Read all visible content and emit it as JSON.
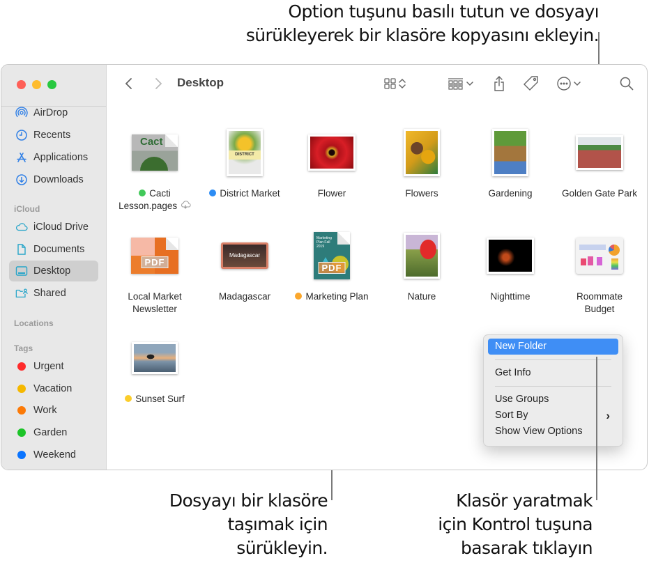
{
  "callouts": {
    "top": [
      "Option tuşunu basılı tutun ve dosyayı",
      "sürükleyerek bir klasöre kopyasını ekleyin."
    ],
    "drag": [
      "Dosyayı bir klasöre",
      "taşımak için",
      "sürükleyin."
    ],
    "control_click": [
      "Klasör yaratmak",
      "için Kontrol tuşuna",
      "basarak tıklayın"
    ]
  },
  "window": {
    "title": "Desktop",
    "traffic_lights": {
      "close": "#fe5f57",
      "minimize": "#febc2e",
      "zoom": "#28c840"
    }
  },
  "toolbar": {
    "back": "back-icon",
    "forward": "forward-icon",
    "view_mode": "icon-grid-icon",
    "group": "group-icon",
    "share": "share-icon",
    "tags": "tag-icon",
    "more": "more-icon",
    "search": "search-icon"
  },
  "sidebar": {
    "favorites": [
      {
        "label": "AirDrop",
        "icon": "airdrop-icon"
      },
      {
        "label": "Recents",
        "icon": "clock-icon"
      },
      {
        "label": "Applications",
        "icon": "applications-icon"
      },
      {
        "label": "Downloads",
        "icon": "download-icon"
      }
    ],
    "icloud_header": "iCloud",
    "icloud": [
      {
        "label": "iCloud Drive",
        "icon": "cloud-icon"
      },
      {
        "label": "Documents",
        "icon": "document-icon"
      },
      {
        "label": "Desktop",
        "icon": "desktop-icon",
        "selected": true
      },
      {
        "label": "Shared",
        "icon": "shared-folder-icon"
      }
    ],
    "locations_header": "Locations",
    "tags_header": "Tags",
    "tags": [
      {
        "label": "Urgent",
        "color": "#fe2b2b"
      },
      {
        "label": "Vacation",
        "color": "#f5b800"
      },
      {
        "label": "Work",
        "color": "#fc7a07"
      },
      {
        "label": "Garden",
        "color": "#1cc428"
      },
      {
        "label": "Weekend",
        "color": "#0a74ff"
      }
    ]
  },
  "files": [
    {
      "name": "Cacti Lesson.pages",
      "line1": "Cacti",
      "line2": "Lesson.pages",
      "tag": "#42c95a",
      "icloud": true
    },
    {
      "name": "District Market",
      "line1": "District Market",
      "tag": "#2c8cf4"
    },
    {
      "name": "Flower",
      "line1": "Flower"
    },
    {
      "name": "Flowers",
      "line1": "Flowers"
    },
    {
      "name": "Gardening",
      "line1": "Gardening"
    },
    {
      "name": "Golden Gate Park",
      "line1": "Golden Gate Park"
    },
    {
      "name": "Local Market Newsletter",
      "line1": "Local Market",
      "line2": "Newsletter",
      "badge": "PDF"
    },
    {
      "name": "Madagascar",
      "line1": "Madagascar"
    },
    {
      "name": "Marketing Plan",
      "line1": "Marketing Plan",
      "tag": "#fba72c",
      "badge": "PDF",
      "doc_text": "Marketing Plan Fall 2019"
    },
    {
      "name": "Nature",
      "line1": "Nature"
    },
    {
      "name": "Nighttime",
      "line1": "Nighttime"
    },
    {
      "name": "Roommate Budget",
      "line1": "Roommate",
      "line2": "Budget"
    },
    {
      "name": "Sunset Surf",
      "line1": "Sunset Surf",
      "tag": "#fbcd2b"
    }
  ],
  "thumb_text": {
    "cacti": "Cact",
    "district": "DISTRICT",
    "madagascar": "Madagascar"
  },
  "context_menu": {
    "items": [
      {
        "label": "New Folder",
        "highlighted": true
      },
      {
        "label": "Get Info"
      },
      {
        "label": "Use Groups"
      },
      {
        "label": "Sort By",
        "submenu": true
      },
      {
        "label": "Show View Options"
      }
    ],
    "submenu_arrow": "›"
  }
}
